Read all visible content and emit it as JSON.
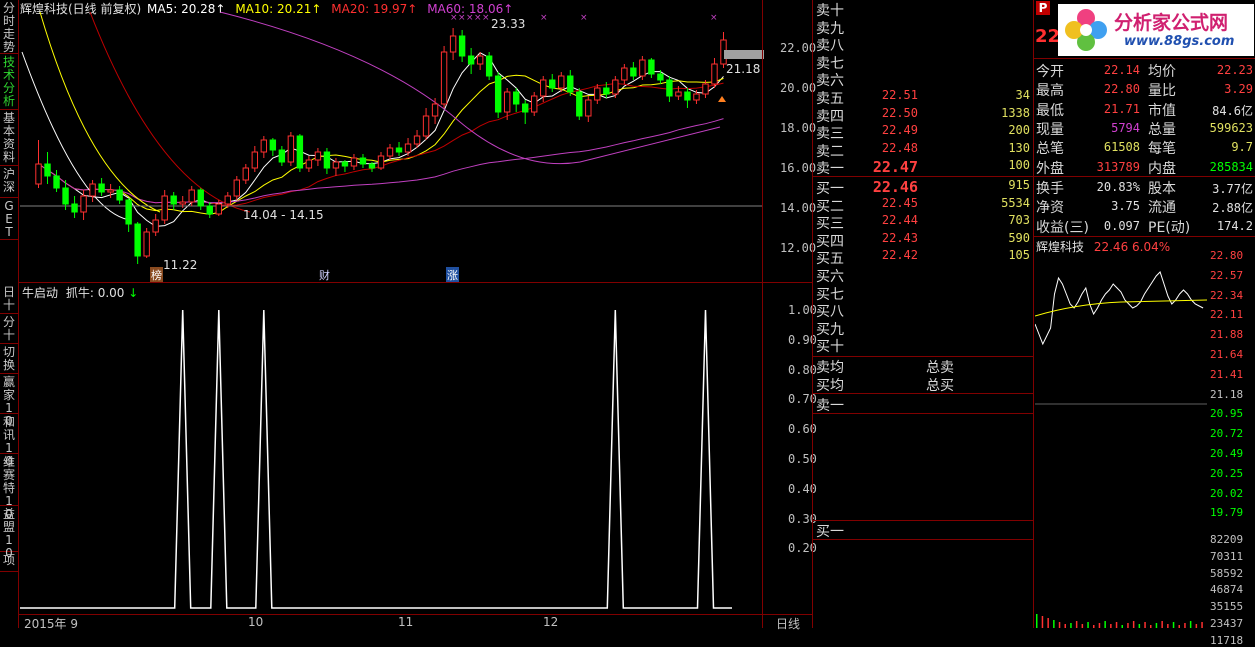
{
  "chart_header": {
    "stock_name": "辉煌科技(日线 前复权)",
    "ma5": "MA5: 20.28↑",
    "ma10": "MA10: 20.21↑",
    "ma20": "MA20: 19.97↑",
    "ma60": "MA60: 18.06↑"
  },
  "colors": {
    "up": "#ff3030",
    "down": "#00ff00",
    "ma5": "#ffffff",
    "ma10": "#ffff00",
    "ma20": "#c00000",
    "ma60": "#c040c0",
    "divider": "#800000"
  },
  "left_tabs": [
    {
      "label": "分时走势"
    },
    {
      "label": "技术分析"
    },
    {
      "label": "基本资料"
    },
    {
      "label": "沪深"
    },
    {
      "label": "GET"
    },
    {
      "label": "日十"
    },
    {
      "label": "分十"
    },
    {
      "label": "切换"
    },
    {
      "label": "赢家10"
    },
    {
      "label": "和讯10"
    },
    {
      "label": "维赛特10"
    },
    {
      "label": "益盟10"
    },
    {
      "label": "项"
    }
  ],
  "price_chart": {
    "annotations": {
      "high": "23.33",
      "low": "11.22",
      "range": "14.04 - 14.15",
      "last": "21.18"
    },
    "markers": [
      {
        "text": "榜"
      },
      {
        "text": "财"
      },
      {
        "text": "涨"
      }
    ],
    "y_ticks": [
      "22.00",
      "20.00",
      "18.00",
      "16.00",
      "14.00",
      "12.00"
    ]
  },
  "indicator": {
    "title": "牛启动",
    "value": "抓牛: 0.00",
    "arrow": "↓",
    "y_ticks": [
      "1.00",
      "0.90",
      "0.80",
      "0.70",
      "0.60",
      "0.50",
      "0.40",
      "0.30",
      "0.20"
    ],
    "spikes_day_index": [
      16,
      20,
      25,
      64,
      74
    ]
  },
  "x_axis": {
    "labels": [
      "2015年 9",
      "10",
      "11",
      "12"
    ],
    "period": "日线"
  },
  "order_book": {
    "asks": [
      {
        "label": "卖十",
        "price": "",
        "vol": ""
      },
      {
        "label": "卖九",
        "price": "",
        "vol": ""
      },
      {
        "label": "卖八",
        "price": "",
        "vol": ""
      },
      {
        "label": "卖七",
        "price": "",
        "vol": ""
      },
      {
        "label": "卖六",
        "price": "",
        "vol": ""
      },
      {
        "label": "卖五",
        "price": "22.51",
        "vol": "34"
      },
      {
        "label": "卖四",
        "price": "22.50",
        "vol": "1338"
      },
      {
        "label": "卖三",
        "price": "22.49",
        "vol": "200"
      },
      {
        "label": "卖二",
        "price": "22.48",
        "vol": "130"
      },
      {
        "label": "卖一",
        "price": "22.47",
        "vol": "100"
      }
    ],
    "bids": [
      {
        "label": "买一",
        "price": "22.46",
        "vol": "915"
      },
      {
        "label": "买二",
        "price": "22.45",
        "vol": "5534"
      },
      {
        "label": "买三",
        "price": "22.44",
        "vol": "703"
      },
      {
        "label": "买四",
        "price": "22.43",
        "vol": "590"
      },
      {
        "label": "买五",
        "price": "22.42",
        "vol": "105"
      },
      {
        "label": "买六",
        "price": "",
        "vol": ""
      },
      {
        "label": "买七",
        "price": "",
        "vol": ""
      },
      {
        "label": "买八",
        "price": "",
        "vol": ""
      },
      {
        "label": "买九",
        "price": "",
        "vol": ""
      },
      {
        "label": "买十",
        "price": "",
        "vol": ""
      }
    ],
    "avg_sell": "卖均",
    "total_sell": "总卖",
    "avg_buy": "买均",
    "total_buy": "总买",
    "queue_sell": "卖一",
    "queue_buy": "买一"
  },
  "logo": {
    "brand": "分析家公式网",
    "url": "www.88gs.com",
    "badge": "P"
  },
  "ticker_price": "22",
  "quote": [
    {
      "l1": "今开",
      "v1": "22.14",
      "c1": "#ff4040",
      "l2": "均价",
      "v2": "22.23",
      "c2": "#ff4040"
    },
    {
      "l1": "最高",
      "v1": "22.80",
      "c1": "#ff4040",
      "l2": "量比",
      "v2": "3.29",
      "c2": "#ff4040"
    },
    {
      "l1": "最低",
      "v1": "21.71",
      "c1": "#ff4040",
      "l2": "市值",
      "v2": "84.6亿",
      "c2": "#e0e0e0"
    },
    {
      "l1": "现量",
      "v1": "5794",
      "c1": "#d040d0",
      "l2": "总量",
      "v2": "599623",
      "c2": "#e0e060"
    },
    {
      "l1": "总笔",
      "v1": "61508",
      "c1": "#e0e060",
      "l2": "每笔",
      "v2": "9.7",
      "c2": "#e0e060"
    },
    {
      "l1": "外盘",
      "v1": "313789",
      "c1": "#ff4040",
      "l2": "内盘",
      "v2": "285834",
      "c2": "#00ff00"
    },
    {
      "l1": "换手",
      "v1": "20.83%",
      "c1": "#e0e0e0",
      "l2": "股本",
      "v2": "3.77亿",
      "c2": "#e0e0e0"
    },
    {
      "l1": "净资",
      "v1": "3.75",
      "c1": "#e0e0e0",
      "l2": "流通",
      "v2": "2.88亿",
      "c2": "#e0e0e0"
    },
    {
      "l1": "收益(三)",
      "v1": "0.097",
      "c1": "#e0e0e0",
      "l2": "PE(动)",
      "v2": "174.2",
      "c2": "#e0e0e0"
    }
  ],
  "mini_chart": {
    "name": "辉煌科技",
    "price_change": "22.46 6.04%",
    "y_ticks": [
      {
        "v": "22.80",
        "c": "#ff4040"
      },
      {
        "v": "22.57",
        "c": "#ff4040"
      },
      {
        "v": "22.34",
        "c": "#ff4040"
      },
      {
        "v": "22.11",
        "c": "#ff4040"
      },
      {
        "v": "21.88",
        "c": "#ff4040"
      },
      {
        "v": "21.64",
        "c": "#ff4040"
      },
      {
        "v": "21.41",
        "c": "#ff4040"
      },
      {
        "v": "21.18",
        "c": "#c0c0c0"
      },
      {
        "v": "20.95",
        "c": "#00ff00"
      },
      {
        "v": "20.72",
        "c": "#00ff00"
      },
      {
        "v": "20.49",
        "c": "#00ff00"
      },
      {
        "v": "20.25",
        "c": "#00ff00"
      },
      {
        "v": "20.02",
        "c": "#00ff00"
      },
      {
        "v": "19.79",
        "c": "#00ff00"
      }
    ],
    "vol_ticks": [
      "82209",
      "70311",
      "58592",
      "46874",
      "35155",
      "23437",
      "11718"
    ]
  },
  "chart_data": {
    "type": "candlestick",
    "y_range": [
      11,
      23.5
    ],
    "candles": [
      [
        15.2,
        16.2,
        17.4,
        15.0
      ],
      [
        16.2,
        15.6,
        16.8,
        15.2
      ],
      [
        15.6,
        15.0,
        15.9,
        14.8
      ],
      [
        15.0,
        14.2,
        15.4,
        13.9
      ],
      [
        14.2,
        13.8,
        14.6,
        13.5
      ],
      [
        13.8,
        14.6,
        14.9,
        13.4
      ],
      [
        14.6,
        15.2,
        15.4,
        14.3
      ],
      [
        15.2,
        14.8,
        15.5,
        14.6
      ],
      [
        14.8,
        14.9,
        15.2,
        14.5
      ],
      [
        14.9,
        14.4,
        15.1,
        14.2
      ],
      [
        14.4,
        13.2,
        14.5,
        12.8
      ],
      [
        13.2,
        11.6,
        13.3,
        11.2
      ],
      [
        11.6,
        12.8,
        13.0,
        11.5
      ],
      [
        12.8,
        13.4,
        13.7,
        12.6
      ],
      [
        13.4,
        14.6,
        14.9,
        13.2
      ],
      [
        14.6,
        14.2,
        14.8,
        13.9
      ],
      [
        14.2,
        14.3,
        14.6,
        14.0
      ],
      [
        14.3,
        14.9,
        15.1,
        14.1
      ],
      [
        14.9,
        14.1,
        15.0,
        13.9
      ],
      [
        14.1,
        13.7,
        14.3,
        13.5
      ],
      [
        13.7,
        14.2,
        14.4,
        13.6
      ],
      [
        14.2,
        14.6,
        14.8,
        14.0
      ],
      [
        14.6,
        15.4,
        15.6,
        14.4
      ],
      [
        15.4,
        16.0,
        16.2,
        15.2
      ],
      [
        16.0,
        16.8,
        17.1,
        15.8
      ],
      [
        16.8,
        17.4,
        17.6,
        16.5
      ],
      [
        17.4,
        16.9,
        17.5,
        16.6
      ],
      [
        16.9,
        16.3,
        17.1,
        16.1
      ],
      [
        16.3,
        17.6,
        17.8,
        16.1
      ],
      [
        17.6,
        16.0,
        17.7,
        15.8
      ],
      [
        16.0,
        16.4,
        16.6,
        15.8
      ],
      [
        16.4,
        16.8,
        17.0,
        16.1
      ],
      [
        16.8,
        16.0,
        17.0,
        15.7
      ],
      [
        16.0,
        16.3,
        16.5,
        15.6
      ],
      [
        16.3,
        16.1,
        16.4,
        15.8
      ],
      [
        16.1,
        16.5,
        16.7,
        15.9
      ],
      [
        16.5,
        16.2,
        16.7,
        16.0
      ],
      [
        16.2,
        16.0,
        16.3,
        15.8
      ],
      [
        16.0,
        16.6,
        16.8,
        15.9
      ],
      [
        16.6,
        17.0,
        17.2,
        16.4
      ],
      [
        17.0,
        16.8,
        17.3,
        16.6
      ],
      [
        16.8,
        17.2,
        17.5,
        16.6
      ],
      [
        17.2,
        17.6,
        17.9,
        17.0
      ],
      [
        17.6,
        18.6,
        19.0,
        17.4
      ],
      [
        18.6,
        19.2,
        19.5,
        18.2
      ],
      [
        19.2,
        21.8,
        22.1,
        19.0
      ],
      [
        21.8,
        22.6,
        23.0,
        21.4
      ],
      [
        22.6,
        21.6,
        22.9,
        21.3
      ],
      [
        21.6,
        21.2,
        22.0,
        20.7
      ],
      [
        21.2,
        21.6,
        21.8,
        20.9
      ],
      [
        21.6,
        20.6,
        21.8,
        20.4
      ],
      [
        20.6,
        18.8,
        20.8,
        18.5
      ],
      [
        18.8,
        19.8,
        20.0,
        18.4
      ],
      [
        19.8,
        19.2,
        20.0,
        18.8
      ],
      [
        19.2,
        18.8,
        19.4,
        18.2
      ],
      [
        18.8,
        19.6,
        19.8,
        18.6
      ],
      [
        19.6,
        20.4,
        20.6,
        19.3
      ],
      [
        20.4,
        20.0,
        20.7,
        19.8
      ],
      [
        20.0,
        20.6,
        20.8,
        19.8
      ],
      [
        20.6,
        19.8,
        20.9,
        19.6
      ],
      [
        19.8,
        18.6,
        20.0,
        18.4
      ],
      [
        18.6,
        19.4,
        19.6,
        18.3
      ],
      [
        19.4,
        20.0,
        20.2,
        19.2
      ],
      [
        20.0,
        19.7,
        20.3,
        19.5
      ],
      [
        19.7,
        20.4,
        20.6,
        19.5
      ],
      [
        20.4,
        21.0,
        21.2,
        20.2
      ],
      [
        21.0,
        20.6,
        21.3,
        20.4
      ],
      [
        20.6,
        21.4,
        21.6,
        20.4
      ],
      [
        21.4,
        20.7,
        21.5,
        20.5
      ],
      [
        20.7,
        20.4,
        20.9,
        20.2
      ],
      [
        20.4,
        19.6,
        20.6,
        19.3
      ],
      [
        19.6,
        19.8,
        20.1,
        19.4
      ],
      [
        19.8,
        19.4,
        20.0,
        19.0
      ],
      [
        19.4,
        19.7,
        19.9,
        19.2
      ],
      [
        19.7,
        20.2,
        20.4,
        19.5
      ],
      [
        20.2,
        21.2,
        21.5,
        20.0
      ],
      [
        21.2,
        22.4,
        22.8,
        21.0
      ]
    ]
  }
}
